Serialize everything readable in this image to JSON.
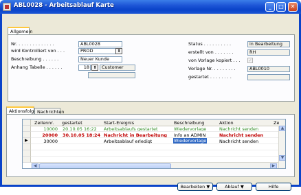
{
  "window": {
    "title": "ABL0028 - Arbeitsablauf Karte"
  },
  "general_tab": {
    "label": "Allgemein"
  },
  "fields": {
    "nr_label": "Nr. . . . . . . . . . . . . .",
    "nr_value": "ABL0028",
    "kontrolliert_label": "wird Kontrolliert von . . .",
    "kontrolliert_value": "PROD",
    "beschreibung_label": "Beschreibung . . . . . .",
    "beschreibung_value": "Neuer Kunde",
    "anhang_label": "Anhang Tabelle . . . . . .",
    "anhang_number": "18",
    "anhang_name": "Customer",
    "status_label": "Status . . . . . . . . . .",
    "status_value": "in Bearbeitung",
    "erstellt_label": "erstellt von . . . . . . .",
    "erstellt_value": "RH",
    "vorlage_kopiert_label": "von Vorlage kopiert . . .",
    "vorlage_kopiert_mark": "✓",
    "vorlage_nr_label": "Vorlage Nr. . . . . . . . .",
    "vorlage_nr_value": "ABL0010",
    "gestartet_label": "gestartet . . . . . . . ."
  },
  "sub_tabs": {
    "aktionsfolge": "Aktionsfolge",
    "nachrichten": "Nachrichten"
  },
  "table": {
    "headers": [
      "Zeilennr.",
      "gestartet",
      "Start-Ereignis",
      "Beschreibung",
      "Aktion",
      "Ze"
    ],
    "rows": [
      {
        "zeilennr": "10000",
        "gestartet": "20.10.05 16:22",
        "ereignis": "Arbeitsablaufs gestartet",
        "beschreibung": "Wiedervorlage",
        "aktion": "Nachricht senden"
      },
      {
        "zeilennr": "20000",
        "gestartet": "30.10.05 18:24",
        "ereignis": "Nachricht in Bearbeitung",
        "beschreibung": "Info an ADMIN",
        "aktion": "Nachricht senden"
      },
      {
        "zeilennr": "30000",
        "gestartet": "",
        "ereignis": "Arbeitsablauf erledigt",
        "beschreibung": "Wiedervorlage",
        "aktion": "Nachricht senden"
      }
    ]
  },
  "buttons": {
    "bearbeiten": "Bearbeiten",
    "ablauf": "Ablauf",
    "hilfe": "Hilfe"
  },
  "colors": {
    "row1": "#2e8b20",
    "row2": "#c00000",
    "selection": "#316ac5"
  }
}
